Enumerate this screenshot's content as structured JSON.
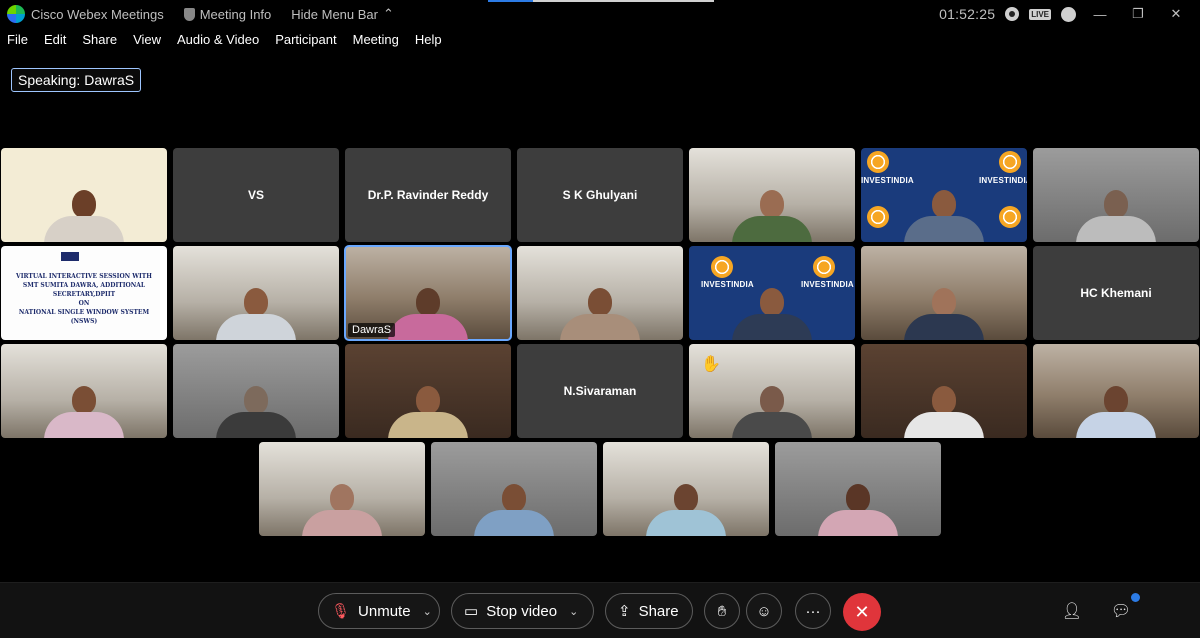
{
  "titlebar": {
    "app_title": "Cisco Webex Meetings",
    "meeting_info": "Meeting Info",
    "hide_menu": "Hide Menu Bar",
    "clock": "01:52:25",
    "live_badge": "LIVE",
    "progress_fraction": 0.2
  },
  "menu": {
    "items": [
      "File",
      "Edit",
      "Share",
      "View",
      "Audio & Video",
      "Participant",
      "Meeting",
      "Help"
    ]
  },
  "speaking": {
    "prefix": "Speaking:",
    "name": "DawraS"
  },
  "tiles": {
    "name_only": {
      "vs": "VS",
      "reddy": "Dr.P. Ravinder Reddy",
      "ghulyani": "S K Ghulyani",
      "khemani": "HC Khemani",
      "sivaraman": "N.Sivaraman"
    },
    "active_label": "DawraS",
    "slide": {
      "line1": "VIRTUAL INTERACTIVE SESSION WITH",
      "line2": "SMT SUMITA DAWRA, ADDITIONAL SECRETARY,DPIIT",
      "line3": "ON",
      "line4": "NATIONAL SINGLE WINDOW SYSTEM (NSWS)",
      "logo": "CII"
    },
    "investindia": "INVESTINDIA"
  },
  "controls": {
    "unmute": "Unmute",
    "stop_video": "Stop video",
    "share": "Share",
    "more": "···",
    "end": "✕"
  },
  "colors": {
    "accent": "#2c7be5",
    "end_call": "#e0353b",
    "speaking_border": "#9ec6ff"
  }
}
